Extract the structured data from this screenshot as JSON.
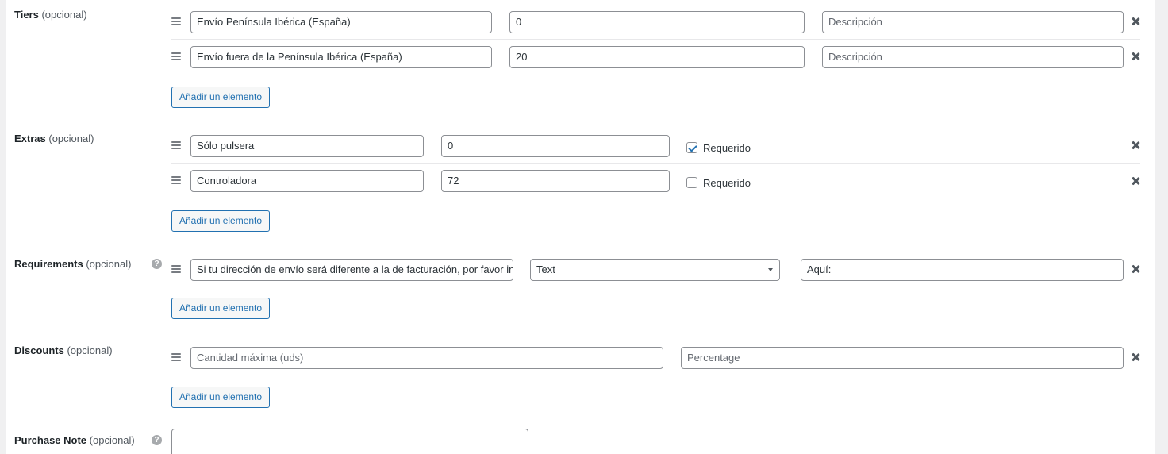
{
  "sections": {
    "tiers": {
      "label": "Tiers",
      "optional": "(opcional)",
      "rows": [
        {
          "name": "Envío Península Ibérica (España)",
          "price": "0",
          "description_placeholder": "Descripción"
        },
        {
          "name": "Envío fuera de la Península Ibérica (España)",
          "price": "20",
          "description_placeholder": "Descripción"
        }
      ],
      "add_button": "Añadir un elemento"
    },
    "extras": {
      "label": "Extras",
      "optional": "(opcional)",
      "rows": [
        {
          "name": "Sólo pulsera",
          "price": "0",
          "required_label": "Requerido",
          "required": true
        },
        {
          "name": "Controladora",
          "price": "72",
          "required_label": "Requerido",
          "required": false
        }
      ],
      "add_button": "Añadir un elemento"
    },
    "requirements": {
      "label": "Requirements",
      "optional": "(opcional)",
      "help_icon": "question-icon",
      "rows": [
        {
          "text": "Si tu dirección de envío será diferente a la de facturación, por favor inc",
          "type": "Text",
          "value": "Aquí:"
        }
      ],
      "add_button": "Añadir un elemento"
    },
    "discounts": {
      "label": "Discounts",
      "optional": "(opcional)",
      "rows": [
        {
          "quantity_placeholder": "Cantidad máxima (uds)",
          "percentage_placeholder": "Percentage"
        }
      ],
      "add_button": "Añadir un elemento"
    },
    "purchase_note": {
      "label": "Purchase Note",
      "optional": "(opcional)",
      "help_icon": "question-icon",
      "value": ""
    }
  },
  "colors": {
    "accent": "#2271b1",
    "border": "#8c8f94",
    "page_bg": "#f0f0f1"
  }
}
